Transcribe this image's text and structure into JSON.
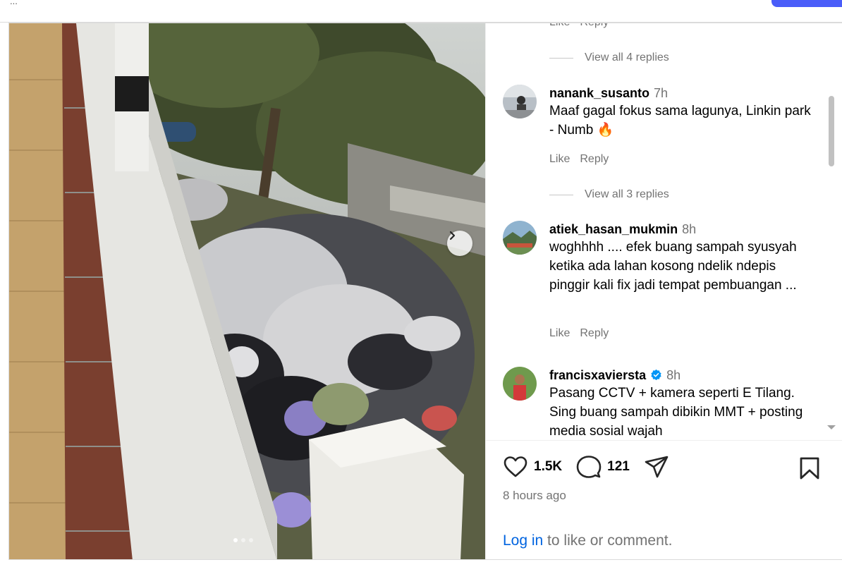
{
  "top": {
    "partial_text": "..."
  },
  "media": {
    "next_icon": "chevron-right-icon",
    "dots": [
      true,
      false,
      false
    ]
  },
  "comments_top": {
    "like": "Like",
    "reply": "Reply",
    "view_replies": "View all 4 replies"
  },
  "comments": [
    {
      "user": "nanank_susanto",
      "time": "7h",
      "text": "Maaf gagal fokus sama lagunya, Linkin park - Numb 🔥",
      "like": "Like",
      "reply": "Reply",
      "view_replies": "View all 3 replies",
      "verified": false
    },
    {
      "user": "atiek_hasan_mukmin",
      "time": "8h",
      "text": "woghhhh .... efek buang sampah syusyah ketika ada lahan kosong ndelik ndepis pinggir kali fix jadi tempat pembuangan ...",
      "like": "Like",
      "reply": "Reply",
      "verified": false
    },
    {
      "user": "francisxaviersta",
      "time": "8h",
      "text": "Pasang CCTV + kamera seperti E Tilang. Sing buang sampah dibikin MMT + posting media sosial wajah",
      "verified": true
    }
  ],
  "footer": {
    "likes": "1.5K",
    "comments": "121",
    "time_ago": "8 hours ago",
    "login_link": "Log in",
    "login_rest": " to like or comment."
  },
  "colors": {
    "link": "#0064e0",
    "muted": "#737373",
    "verified": "#0095f6"
  }
}
